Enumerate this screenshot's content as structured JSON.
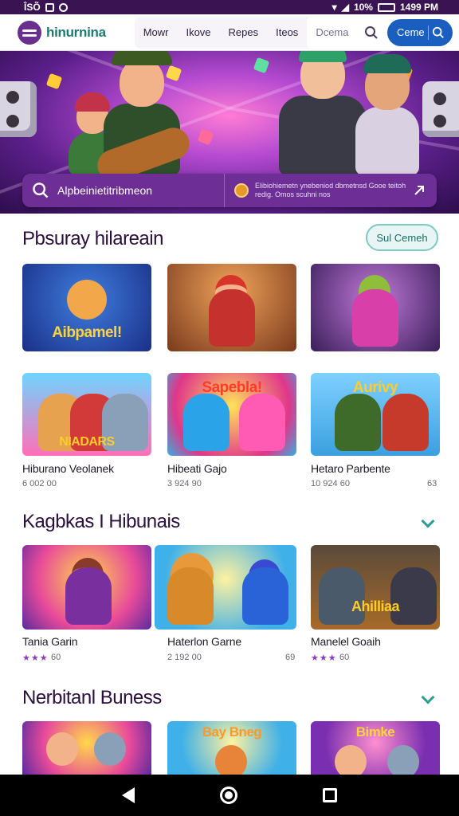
{
  "status_bar": {
    "left_text": "ÎSÕ",
    "right_battery": "10%",
    "time": "1499 PM"
  },
  "header": {
    "app_name": "hinurnina",
    "nav": [
      "Mowr",
      "Ikove",
      "Repes",
      "Iteos",
      "Dcema"
    ],
    "pill_label": "Ceme"
  },
  "hero": {
    "search_text": "Alpbeinietitribmeon",
    "info_text": "Elibiohiemetn ynebeniod dbmetnsd Gooe teitoh redig. Omos scuhni nos"
  },
  "section1": {
    "title": "Pbsuray hilareain",
    "see_all": "Sul Cemeh",
    "cards": [
      {
        "banner": "Aibpamel!",
        "title": "",
        "meta": ""
      },
      {
        "banner": "",
        "title": "",
        "meta": ""
      },
      {
        "banner": "",
        "title": "",
        "meta": ""
      },
      {
        "banner": "NIADARS",
        "title": "Hiburano Veolanek",
        "meta": "6 002 00"
      },
      {
        "banner": "Sapebla!",
        "title": "Hibeati Gajo",
        "meta": "3 924 90"
      },
      {
        "banner": "Aurivy",
        "title": "Hetaro Parbente",
        "meta": "10 924 60",
        "extra": "63"
      }
    ]
  },
  "section2": {
    "title": "Kagbkas I Hibunais",
    "cards": [
      {
        "banner": "",
        "title": "Tania Garin",
        "stars": "★★★",
        "count": "60"
      },
      {
        "banner": "",
        "title": "Haterlon Garne",
        "meta": "2 192 00",
        "extra": "69"
      },
      {
        "banner": "Ahilliaa",
        "title": "Manelel Goaih",
        "stars": "★★★",
        "count": "60"
      }
    ]
  },
  "section3": {
    "title": "Nerbitanl Buness",
    "cards": [
      {
        "banner": ""
      },
      {
        "banner": "Bay Bneg"
      },
      {
        "banner": "Bimke"
      }
    ]
  },
  "colors": {
    "brand_purple": "#6d2e96",
    "accent_blue": "#1a5fc0",
    "accent_teal": "#2a9e8f"
  }
}
